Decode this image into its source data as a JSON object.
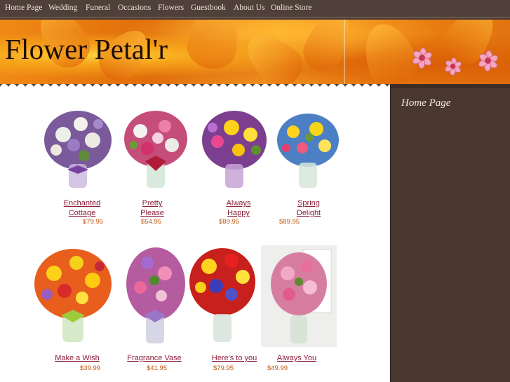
{
  "nav": {
    "items": [
      "Home Page",
      "Wedding",
      "Funeral",
      "Occasions",
      "Flowers",
      "Guestbook",
      "About Us",
      "Online Store"
    ]
  },
  "header": {
    "title": "Flower Petal'r"
  },
  "sidebar": {
    "title": "Home Page"
  },
  "products": [
    {
      "name": "Enchanted\nCottage",
      "price": "$79.95"
    },
    {
      "name": "Pretty\nPlease",
      "price": "$54.95"
    },
    {
      "name": "Always\nHappy",
      "price": "$89.95"
    },
    {
      "name": "Spring\nDelight",
      "price": "$89.95"
    },
    {
      "name": "Make a Wish",
      "price": "$39.99"
    },
    {
      "name": "Fragrance Vase",
      "price": "$41.95"
    },
    {
      "name": "Here's to you",
      "price": "$79.95"
    },
    {
      "name": "Always You",
      "price": "$49.99"
    }
  ],
  "colors": {
    "nav_bg": "#4f4039",
    "sidebar_bg": "#4a3830",
    "link": "#8b1e3a",
    "price": "#c05a14"
  }
}
